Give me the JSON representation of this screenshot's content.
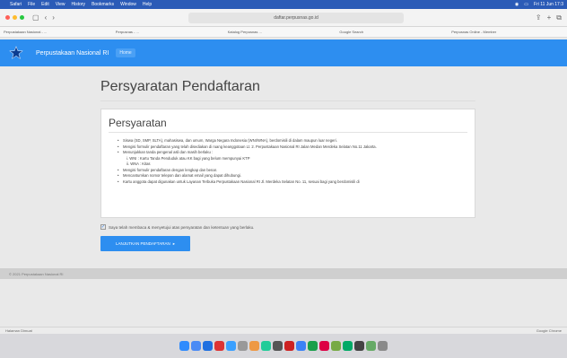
{
  "menubar": {
    "items": [
      "Safari",
      "File",
      "Edit",
      "View",
      "History",
      "Bookmarks",
      "Window",
      "Help"
    ],
    "right_time": "Fri 11 Jun 17:3"
  },
  "browser": {
    "url": "daftar.perpusnas.go.id",
    "bookmarks": [
      "Perpustakaan Nasional - ...",
      "Perpusnas - ...",
      "Katalog Perpusnas ...",
      "Google Search",
      "Perpusnas Online - Member"
    ]
  },
  "navbar": {
    "brand": "Perpustakaan Nasional RI",
    "home": "Home"
  },
  "page": {
    "title": "Persyaratan Pendaftaran",
    "panel_title": "Persyaratan",
    "items": [
      "Siswa (SD, SMP, SLTA), mahasiswa, dan umum, Warga Negara Indonesia (WNI/WNA), berdomisili di dalam maupun luar negeri.",
      "Mengisi formulir pendaftaran yang telah disediakan di ruang keanggotaan Lt. 2. Perpustakaan Nasional RI Jalan Medan Merdeka Selatan No.11 Jakarta.",
      "Menunjukkan tanda pengenal asli dan masih berlaku :",
      "WNI : Kartu Tanda Penduduk atau KK bagi yang belum mempunyai KTP",
      "WNA : Kitas",
      "Mengisi formulir pendaftaran dengan lengkap dan benar.",
      "Mencantumkan nomor telepon dan alamat email yang dapat dihubungi.",
      "Kartu anggota dapat digunakan untuk Layanan Terbuka Perpustakaan Nasional RI Jl. Merdeka Selatan No. 11, sesuai bagi yang berdomisili di"
    ],
    "agree_text": "Saya telah membaca & menyetujui atas persyaratan dan ketentuan yang berlaku.",
    "button": "LANJUTKAN PENDAFTARAN"
  },
  "footer": {
    "text": "© 2021 Perpustakaan Nasional RI"
  },
  "status": {
    "left": "Halaman Dimuat",
    "right": "Google Chrome"
  },
  "colors": {
    "accent": "#2d8ef0",
    "menubar": "#2b5bb7"
  }
}
